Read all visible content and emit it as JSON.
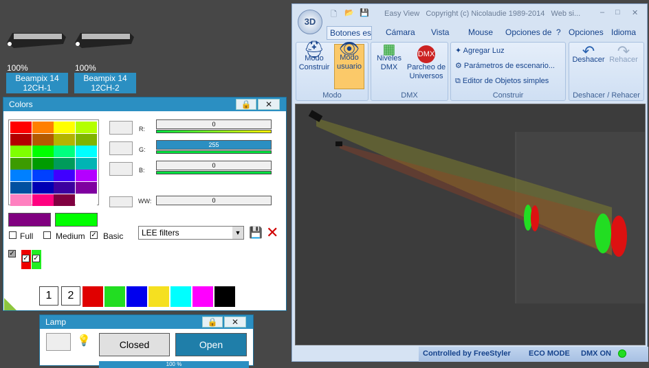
{
  "fixtures": [
    {
      "percent": "100%",
      "name1": "Beampix 14",
      "name2": "12CH-1"
    },
    {
      "percent": "100%",
      "name1": "Beampix 14",
      "name2": "12CH-2"
    }
  ],
  "colors": {
    "title": "Colors",
    "r_label": "R:",
    "g_label": "G:",
    "b_label": "B:",
    "ww_label": "WW:",
    "r_value": "0",
    "g_value": "255",
    "b_value": "0",
    "ww_value": "0",
    "full_label": "Full",
    "medium_label": "Medium",
    "basic_label": "Basic",
    "filter_select": "LEE filters",
    "btn1": "1",
    "btn2": "2",
    "grid": [
      "#ff0000",
      "#ff7f00",
      "#ffff00",
      "#b4ff00",
      "#b40000",
      "#b45a00",
      "#b4b400",
      "#7fb400",
      "#7fff00",
      "#00ff00",
      "#00ff7f",
      "#00ffff",
      "#3c9b00",
      "#009b00",
      "#009b5a",
      "#00b4b4",
      "#0080ff",
      "#0040ff",
      "#4000ff",
      "#b400ff",
      "#0050a0",
      "#0000b4",
      "#3c00a0",
      "#7f00a0",
      "#ff80c0",
      "#ff0080",
      "#800040",
      "#ffffff"
    ],
    "palette": [
      "#e00000",
      "#22dd22",
      "#0000ee",
      "#f5e020",
      "#00ffff",
      "#ff00ff",
      "#000000"
    ]
  },
  "lamp": {
    "title": "Lamp",
    "closed": "Closed",
    "open": "Open",
    "bar_value": "100 %"
  },
  "app": {
    "title": "Easy View   Copyright (c) Nicolaudie 1989-2014   Web si...",
    "tabs": [
      "Botones esta",
      "Cámara",
      "Vista",
      "Mouse",
      "Opciones de",
      "?",
      "Opciones",
      "Idioma"
    ],
    "modo_construir": "Modo\nConstruir",
    "modo_usuario": "Modo\nusuario",
    "modo_group": "Modo",
    "niveles": "Niveles\nDMX",
    "parcheo": "Parcheo de\nUniversos",
    "dmx_group": "DMX",
    "agregar": "Agregar Luz",
    "parametros": "Parámetros de escenario...",
    "editor": "Editor de Objetos simples",
    "construir_group": "Construir",
    "deshacer": "Deshacer",
    "rehacer": "Rehacer",
    "undo_group": "Deshacer / Rehacer",
    "status": {
      "controlled": "Controlled by FreeStyler",
      "eco": "ECO MODE",
      "dmx": "DMX ON"
    }
  }
}
